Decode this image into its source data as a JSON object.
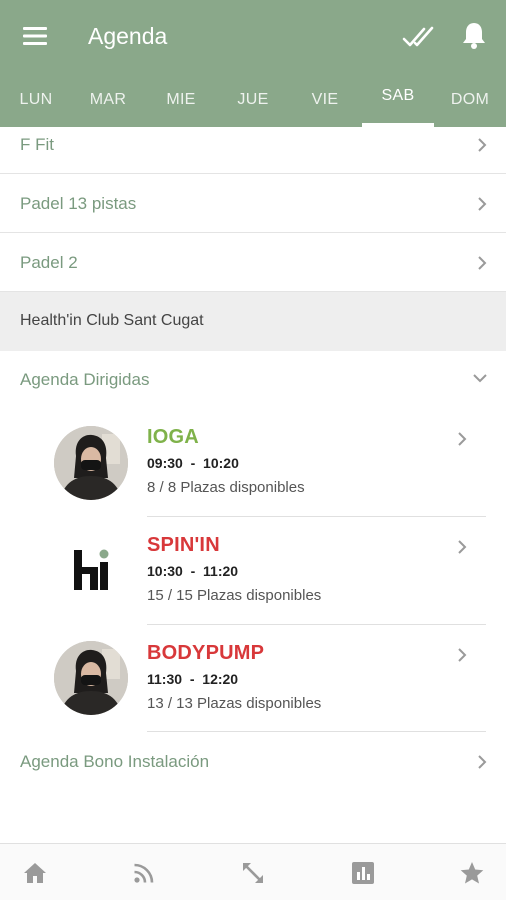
{
  "header": {
    "title": "Agenda",
    "bg_color": "#8aa88a"
  },
  "days": [
    {
      "label": "LUN",
      "active": false
    },
    {
      "label": "MAR",
      "active": false
    },
    {
      "label": "MIE",
      "active": false
    },
    {
      "label": "JUE",
      "active": false
    },
    {
      "label": "VIE",
      "active": false
    },
    {
      "label": "SAB",
      "active": true
    },
    {
      "label": "DOM",
      "active": false
    }
  ],
  "list": {
    "rows": [
      {
        "label": "F Fit"
      },
      {
        "label": "Padel 13 pistas"
      },
      {
        "label": "Padel 2"
      }
    ],
    "section_header": "Health'in Club Sant Cugat",
    "group": {
      "label": "Agenda Dirigidas",
      "expanded": true,
      "classes": [
        {
          "name": "IOGA",
          "color": "#7fb24a",
          "start": "09:30",
          "sep": "-",
          "end": "10:20",
          "places": "8 / 8 Plazas disponibles",
          "image": "instructor-avatar"
        },
        {
          "name": "SPIN'IN",
          "color": "#d8383a",
          "start": "10:30",
          "sep": "-",
          "end": "11:20",
          "places": "15 / 15 Plazas disponibles",
          "image": "hi-logo"
        },
        {
          "name": "BODYPUMP",
          "color": "#d8383a",
          "start": "11:30",
          "sep": "-",
          "end": "12:20",
          "places": "13 / 13 Plazas disponibles",
          "image": "instructor-avatar"
        }
      ]
    },
    "footer_row": {
      "label": "Agenda Bono Instalación"
    }
  },
  "bottom_nav": [
    {
      "icon": "home-icon"
    },
    {
      "icon": "feed-icon"
    },
    {
      "icon": "expand-icon"
    },
    {
      "icon": "stats-icon"
    },
    {
      "icon": "star-icon"
    }
  ]
}
